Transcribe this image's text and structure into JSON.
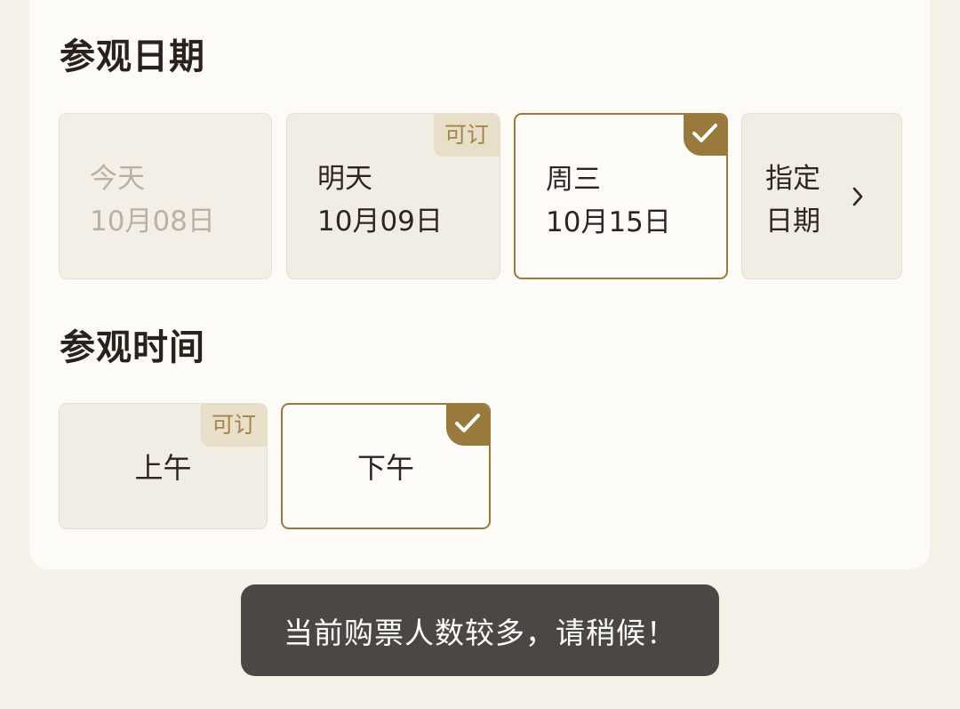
{
  "visit_date": {
    "title": "参观日期",
    "options": [
      {
        "line1": "今天",
        "line2": "10月08日",
        "state": "disabled"
      },
      {
        "line1": "明天",
        "line2": "10月09日",
        "state": "available",
        "tag": "可订"
      },
      {
        "line1": "周三",
        "line2": "10月15日",
        "state": "selected"
      },
      {
        "line1": "指定",
        "line2": "日期",
        "state": "picker",
        "icon": "chevron-right-icon"
      }
    ]
  },
  "visit_time": {
    "title": "参观时间",
    "options": [
      {
        "label": "上午",
        "state": "available",
        "tag": "可订"
      },
      {
        "label": "下午",
        "state": "selected"
      }
    ]
  },
  "toast": {
    "message": "当前购票人数较多，请稍候！"
  },
  "colors": {
    "page_bg": "#f5f1e8",
    "card_bg": "#fcfbf7",
    "accent": "#9a7a3c",
    "tag_bg": "#e8dfcb",
    "tag_text": "#a48545",
    "toast_bg": "#4a4744"
  }
}
